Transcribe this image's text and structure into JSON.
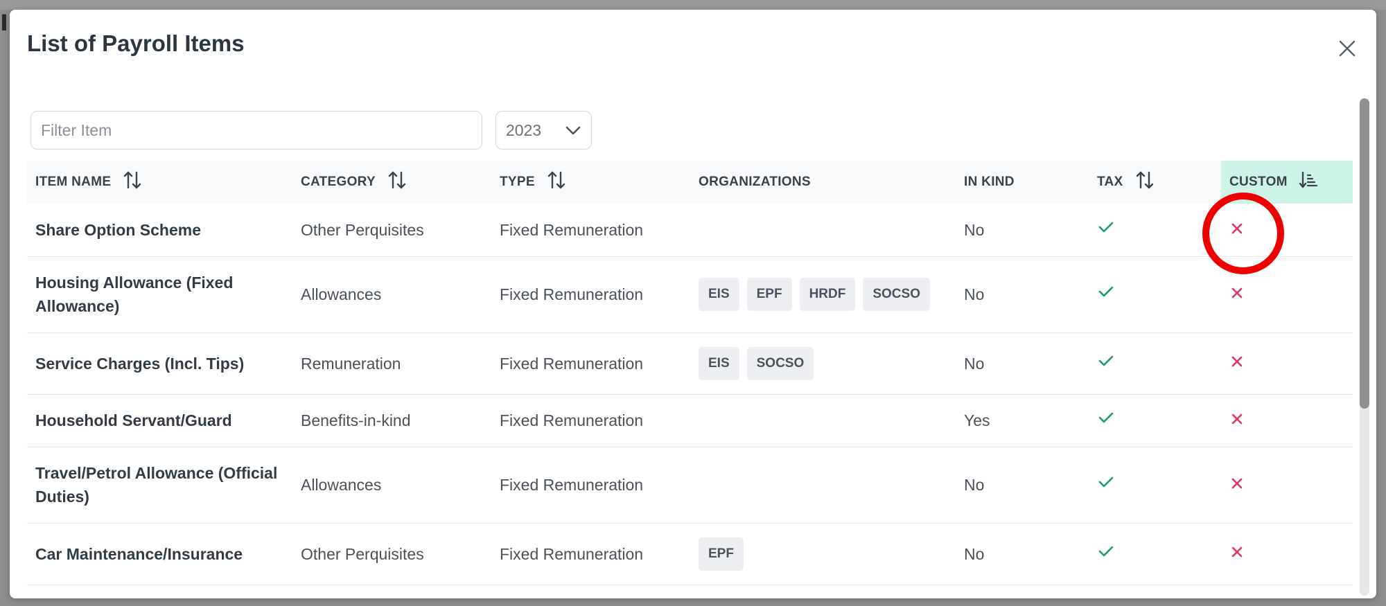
{
  "background": {
    "partial_text": "II"
  },
  "modal": {
    "title": "List of Payroll Items",
    "close_icon": "close-icon"
  },
  "filter": {
    "placeholder": "Filter Item"
  },
  "year_select": {
    "value": "2023"
  },
  "table": {
    "columns": [
      {
        "label": "ITEM NAME",
        "sortable": true
      },
      {
        "label": "CATEGORY",
        "sortable": true
      },
      {
        "label": "TYPE",
        "sortable": true
      },
      {
        "label": "ORGANIZATIONS",
        "sortable": false
      },
      {
        "label": "IN KIND",
        "sortable": false
      },
      {
        "label": "TAX",
        "sortable": true
      },
      {
        "label": "CUSTOM",
        "sortable": true,
        "active": true
      }
    ],
    "rows": [
      {
        "name": "Share Option Scheme",
        "category": "Other Perquisites",
        "type": "Fixed Remuneration",
        "organizations": [],
        "in_kind": "No",
        "tax": true,
        "custom": false
      },
      {
        "name": "Housing Allowance (Fixed Allowance)",
        "category": "Allowances",
        "type": "Fixed Remuneration",
        "organizations": [
          "EIS",
          "EPF",
          "HRDF",
          "SOCSO"
        ],
        "in_kind": "No",
        "tax": true,
        "custom": false
      },
      {
        "name": "Service Charges (Incl. Tips)",
        "category": "Remuneration",
        "type": "Fixed Remuneration",
        "organizations": [
          "EIS",
          "SOCSO"
        ],
        "in_kind": "No",
        "tax": true,
        "custom": false
      },
      {
        "name": "Household Servant/Guard",
        "category": "Benefits-in-kind",
        "type": "Fixed Remuneration",
        "organizations": [],
        "in_kind": "Yes",
        "tax": true,
        "custom": false
      },
      {
        "name": "Travel/Petrol Allowance (Official Duties)",
        "category": "Allowances",
        "type": "Fixed Remuneration",
        "organizations": [],
        "in_kind": "No",
        "tax": true,
        "custom": false
      },
      {
        "name": "Car Maintenance/Insurance",
        "category": "Other Perquisites",
        "type": "Fixed Remuneration",
        "organizations": [
          "EPF"
        ],
        "in_kind": "No",
        "tax": true,
        "custom": false
      }
    ]
  },
  "colors": {
    "check": "#1a9a6c",
    "cross": "#e0355a",
    "active_header": "#cdf3e8",
    "highlight": "#ee0000"
  }
}
